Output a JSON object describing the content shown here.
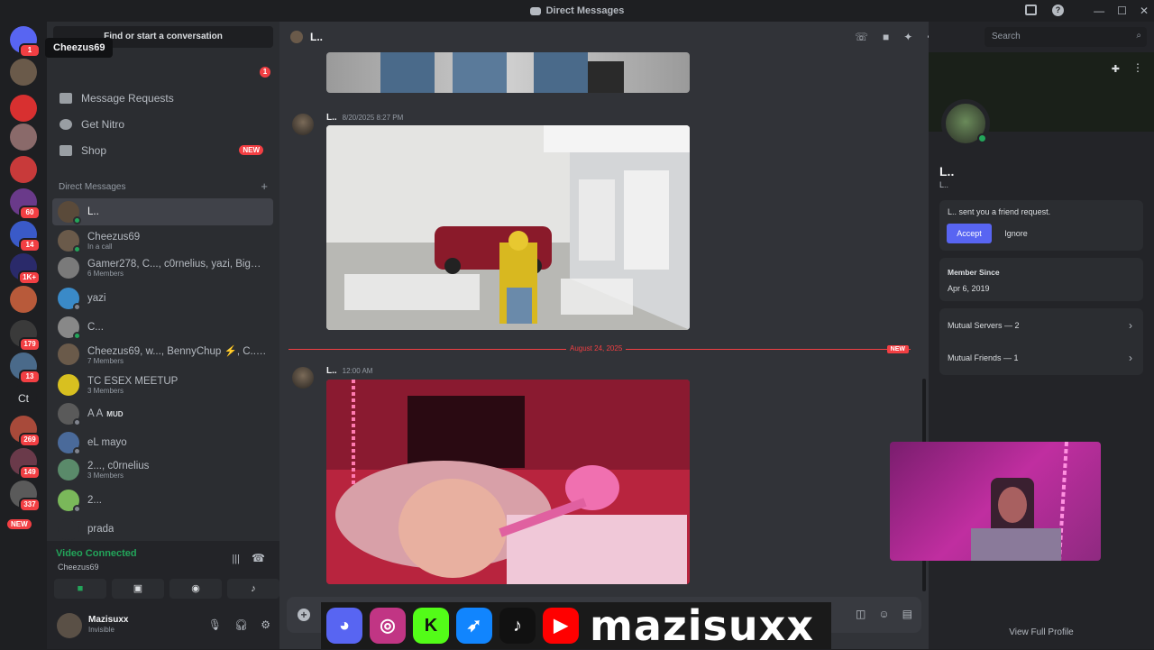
{
  "window": {
    "title": "Direct Messages"
  },
  "tooltip": "Cheezus69",
  "sidebar": {
    "find_placeholder": "Find or start a conversation",
    "nav": [
      {
        "label": "Message Requests",
        "icon": "inbox-icon"
      },
      {
        "label": "Get Nitro",
        "icon": "nitro-icon"
      },
      {
        "label": "Shop",
        "icon": "shop-icon",
        "badge": "NEW"
      }
    ],
    "friends_badge": "1",
    "dm_header": "Direct Messages",
    "dm_add": "+",
    "dms": [
      {
        "name": "L..",
        "sub": "",
        "color": "#5a4a3a",
        "status": "#23a55a"
      },
      {
        "name": "Cheezus69",
        "sub": "In a call",
        "color": "#6a5a4a",
        "status": "#23a55a"
      },
      {
        "name": "Gamer278, C..., c0rnelius, yazi, BigSh...",
        "sub": "6 Members",
        "color": "#7a7a7a",
        "status": ""
      },
      {
        "name": "yazi",
        "sub": "",
        "color": "#3a8ac8",
        "status": "#80848e"
      },
      {
        "name": "C...",
        "sub": "",
        "color": "#888888",
        "status": "#23a55a"
      },
      {
        "name": "Cheezus69, w..., BennyChup ⚡, C..., ...",
        "sub": "7 Members",
        "color": "#6a5a4a",
        "status": ""
      },
      {
        "name": "TC ESEX MEETUP",
        "sub": "3 Members",
        "color": "#d8c020",
        "status": ""
      },
      {
        "name": "A A",
        "sub": "",
        "color": "#5a5a5a",
        "status": "#80848e",
        "tag": "MUD"
      },
      {
        "name": "eL mayo",
        "sub": "",
        "color": "#4a6a9a",
        "status": "#80848e"
      },
      {
        "name": "2..., c0rnelius",
        "sub": "3 Members",
        "color": "#5a8a6a",
        "status": ""
      },
      {
        "name": "2...",
        "sub": "",
        "color": "#7ab85a",
        "status": "#80848e"
      },
      {
        "name": "prada",
        "sub": "",
        "color": "#2b2d31",
        "status": ""
      }
    ],
    "voice": {
      "status": "Video Connected",
      "channel": "Cheezus69"
    },
    "user": {
      "name": "Mazisuxx",
      "status": "Invisible"
    }
  },
  "rail": {
    "servers": [
      {
        "name": "discord-home",
        "color": "#5865f2",
        "badge": "1"
      },
      {
        "name": "server-cheezus",
        "color": "#6a5a4a",
        "badge": ""
      },
      {
        "name": "server-t",
        "color": "#d83030",
        "badge": ""
      },
      {
        "name": "server-face",
        "color": "#8a6a6a",
        "badge": ""
      },
      {
        "name": "server-hl",
        "color": "#c83a3a",
        "badge": ""
      },
      {
        "name": "server-purple",
        "color": "#6a3a8a",
        "badge": "60"
      },
      {
        "name": "server-ch",
        "color": "#3a5ac8",
        "badge": "14"
      },
      {
        "name": "server-team",
        "color": "#2a2a6a",
        "badge": "1K+"
      },
      {
        "name": "server-orange",
        "color": "#b85a3a",
        "badge": ""
      },
      {
        "name": "server-dark",
        "color": "#3a3a3a",
        "badge": "179"
      },
      {
        "name": "server-blue",
        "color": "#4a6a8a",
        "badge": "13"
      },
      {
        "name": "server-ct",
        "color": "#1e1f22",
        "badge": "",
        "label": "Ct"
      },
      {
        "name": "server-red",
        "color": "#a84a3a",
        "badge": "269"
      },
      {
        "name": "server-anime",
        "color": "#6a3a4a",
        "badge": "149"
      },
      {
        "name": "server-gray",
        "color": "#5a5a5a",
        "badge": "337"
      }
    ],
    "new_label": "NEW"
  },
  "chat": {
    "header_name": "L..",
    "messages": [
      {
        "author": "L..",
        "time": "8/20/2025 8:27 PM"
      },
      {
        "author": "L..",
        "time": "12:00 AM"
      }
    ],
    "divider_date": "August 24, 2025",
    "divider_new": "NEW"
  },
  "profile": {
    "search_placeholder": "Search",
    "name": "L..",
    "username": "L..",
    "friend_request": "L.. sent you a friend request.",
    "accept": "Accept",
    "ignore": "Ignore",
    "member_since_label": "Member Since",
    "member_since": "Apr 6, 2019",
    "mutual_servers": "Mutual Servers — 2",
    "mutual_friends": "Mutual Friends — 1",
    "view_full": "View Full Profile"
  },
  "overlay": {
    "brand": "mazisuxx",
    "icons": [
      "discord-icon",
      "instagram-icon",
      "kick-icon",
      "bluesky-icon",
      "tiktok-icon",
      "youtube-icon"
    ]
  },
  "colors": {
    "accent": "#5865f2",
    "online": "#23a55a",
    "danger": "#f23f43"
  }
}
